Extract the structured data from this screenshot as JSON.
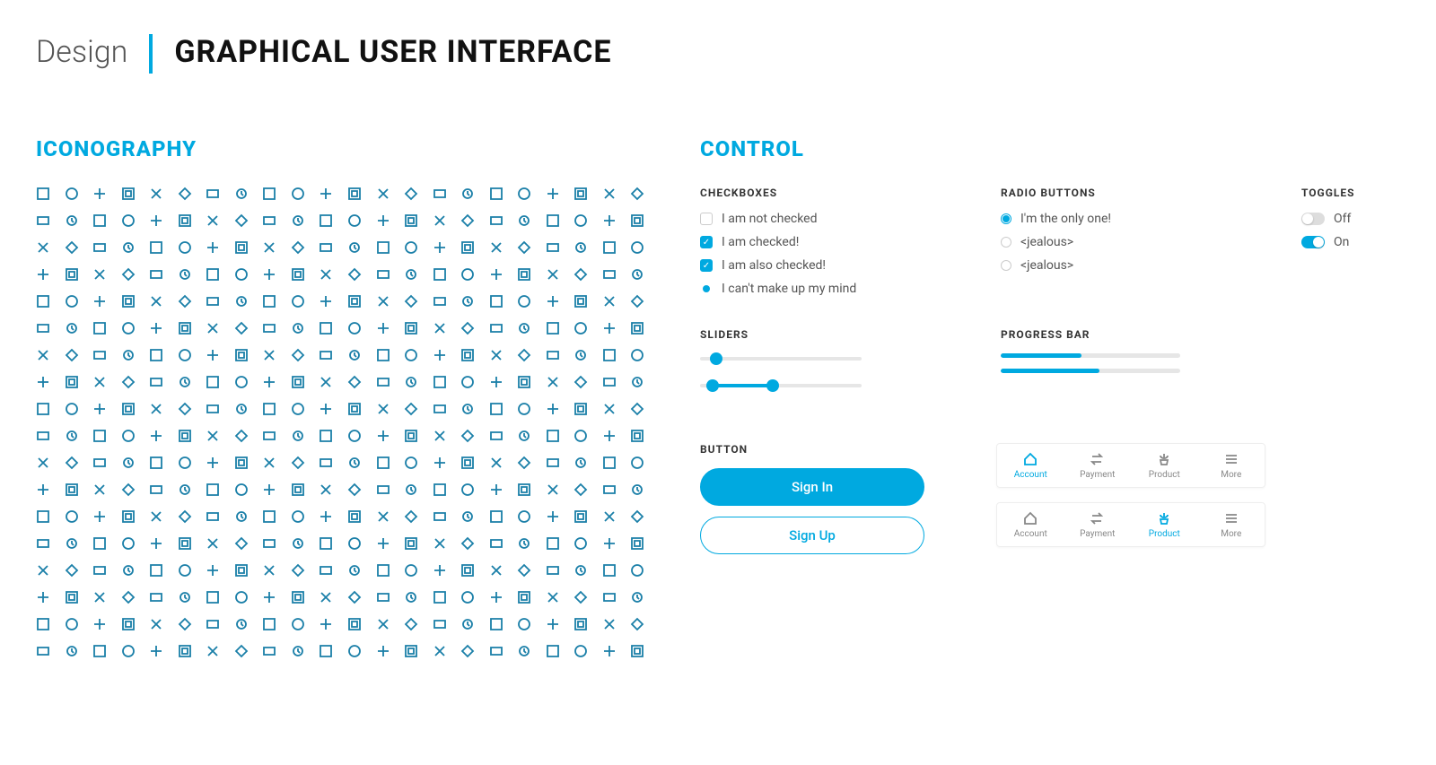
{
  "header": {
    "pre": "Design",
    "title": "GRAPHICAL USER INTERFACE"
  },
  "sections": {
    "iconography": "ICONOGRAPHY",
    "control": "CONTROL",
    "checkboxes": "CHECKBOXES",
    "radio": "RADIO BUTTONS",
    "toggles": "TOGGLES",
    "sliders": "SLIDERS",
    "progress": "PROGRESS BAR",
    "button": "BUTTON"
  },
  "colors": {
    "accent": "#00a9e0"
  },
  "iconography": {
    "rows": 18,
    "cols": 22,
    "total": 396
  },
  "checkboxes": [
    {
      "label": "I am not checked",
      "state": "unchecked"
    },
    {
      "label": "I am checked!",
      "state": "checked"
    },
    {
      "label": "I am also checked!",
      "state": "checked"
    },
    {
      "label": "I can't make up my mind",
      "state": "indeterminate"
    }
  ],
  "radios": [
    {
      "label": "I'm the only one!",
      "state": "on"
    },
    {
      "label": "<jealous>",
      "state": "off"
    },
    {
      "label": "<jealous>",
      "state": "off"
    }
  ],
  "toggles": [
    {
      "label": "Off",
      "state": "off"
    },
    {
      "label": "On",
      "state": "on"
    }
  ],
  "sliders": [
    {
      "type": "single",
      "value": 10,
      "min": 0,
      "max": 100
    },
    {
      "type": "range",
      "low": 8,
      "high": 45,
      "min": 0,
      "max": 100
    }
  ],
  "progress": [
    {
      "value": 45,
      "max": 100
    },
    {
      "value": 55,
      "max": 100
    }
  ],
  "buttons": {
    "primary": "Sign In",
    "outline": "Sign Up"
  },
  "tabbars": [
    {
      "active": 0,
      "tabs": [
        {
          "label": "Account",
          "icon": "home-icon"
        },
        {
          "label": "Payment",
          "icon": "swap-icon"
        },
        {
          "label": "Product",
          "icon": "plant-icon"
        },
        {
          "label": "More",
          "icon": "menu-icon"
        }
      ]
    },
    {
      "active": 2,
      "tabs": [
        {
          "label": "Account",
          "icon": "home-icon"
        },
        {
          "label": "Payment",
          "icon": "swap-icon"
        },
        {
          "label": "Product",
          "icon": "plant-icon"
        },
        {
          "label": "More",
          "icon": "menu-icon"
        }
      ]
    }
  ]
}
